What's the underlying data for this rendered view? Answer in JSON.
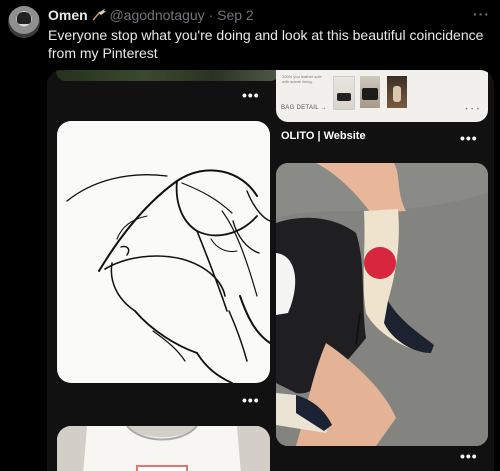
{
  "tweet": {
    "author_name": "Omen",
    "author_handle": "@agodnotaguy",
    "separator": "·",
    "date": "Sep 2",
    "more_label": "···",
    "text": "Everyone stop what you're doing and look at this beautiful coincidence from my Pinterest"
  },
  "pins": {
    "bag_card": {
      "tiny_text": "100% you leather sole with suede lining.",
      "link_label": "BAG DETAIL →",
      "pager_dots": "• • •"
    },
    "olito_title": "OLITO | Website",
    "menu_label": "•••"
  },
  "icons": {
    "author_badge": "broom-emoji-icon"
  },
  "colors": {
    "background": "#000000",
    "secondary_text": "#71767b",
    "primary_text": "#e7e9ea",
    "boot_red": "#d7263d"
  }
}
